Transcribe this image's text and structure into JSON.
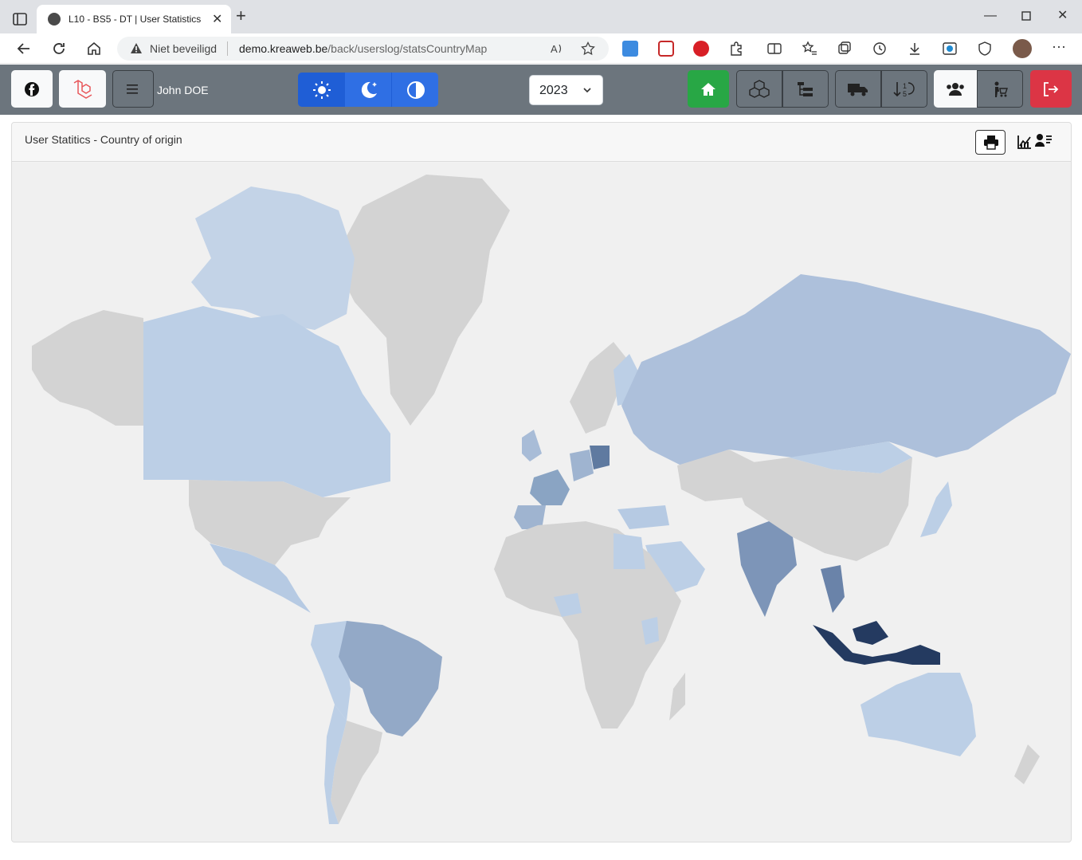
{
  "browser": {
    "tab_title": "L10 - BS5 - DT | User Statistics",
    "security_label": "Niet beveiligd",
    "url_host": "demo.kreaweb.be",
    "url_path": "/back/userslog/statsCountryMap"
  },
  "navbar": {
    "user_name": "John DOE",
    "year_selected": "2023",
    "colors": {
      "bg": "#6c757d",
      "theme_primary": "#2f6fe4",
      "home": "#28a745",
      "logout": "#dc3545"
    }
  },
  "card": {
    "title": "User Statitics - Country of origin"
  },
  "map": {
    "legend_min": "0",
    "legend_max": "27",
    "scale_colors": [
      "#bdd1e8",
      "#8aa4c3",
      "#243a60"
    ],
    "no_data_color": "#d3d3d3"
  }
}
